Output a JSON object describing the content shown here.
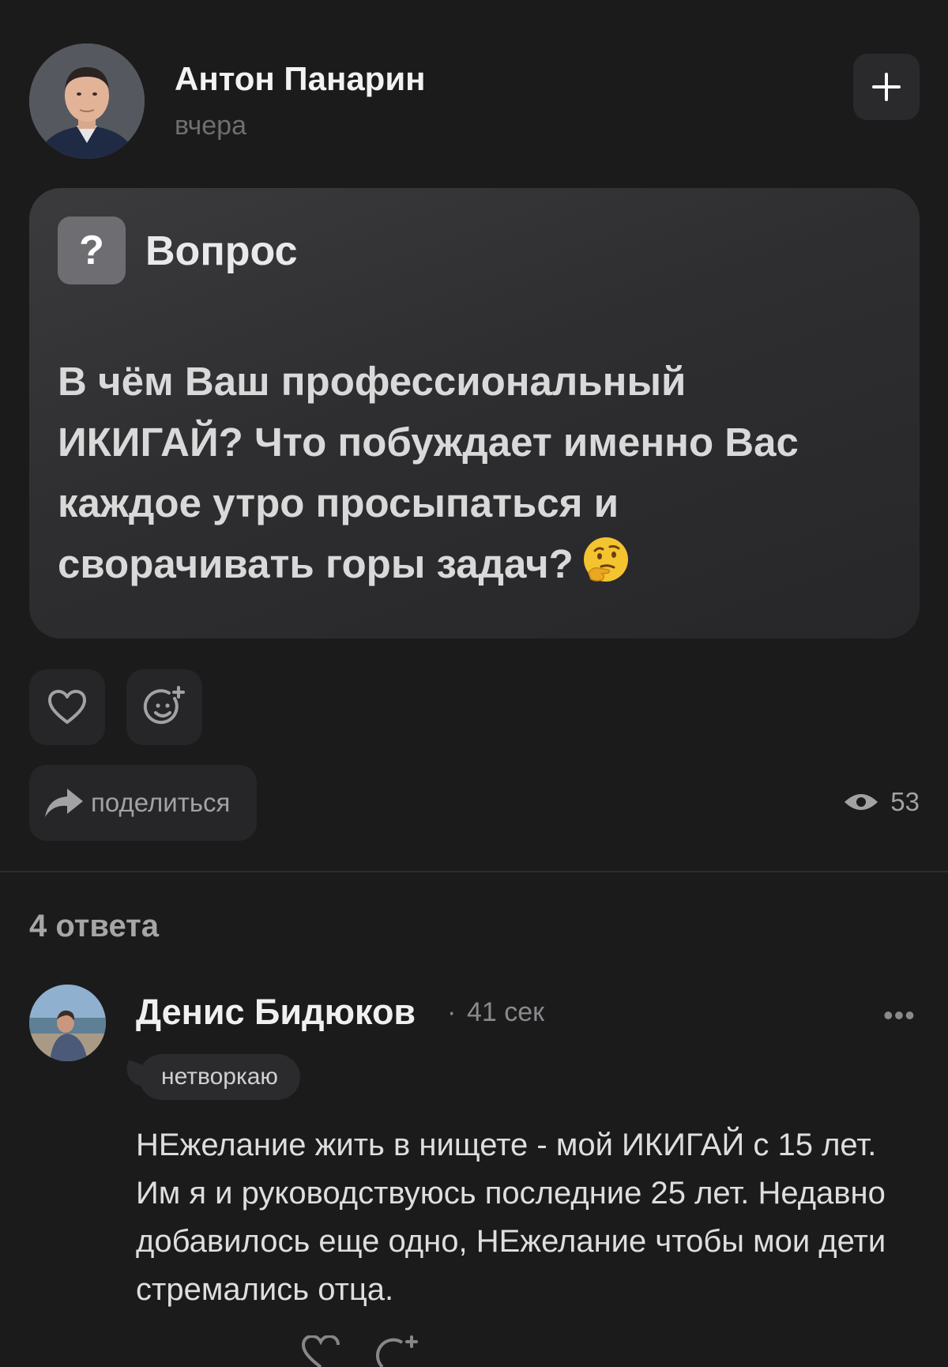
{
  "post": {
    "author": "Антон Панарин",
    "time": "вчера",
    "add_label": "+",
    "question_badge": "?",
    "question_label": "Вопрос",
    "question_text": "В чём Ваш профессиональный ИКИГАЙ? Что побуждает именно Вас каждое утро просыпаться и сворачивать горы задач?",
    "share_label": "поделиться",
    "views": "53"
  },
  "answers": {
    "count_label": "4 ответа",
    "items": [
      {
        "author": "Денис Бидюков",
        "separator": "·",
        "time": "41 сек",
        "more_label": "•••",
        "tag": "нетворкаю",
        "text": "НЕжелание жить в нищете - мой ИКИГАЙ с 15 лет. Им я и руководствуюсь последние 25 лет. Недавно добавилось еще одно, НЕжелание чтобы мои дети стремались отца."
      }
    ]
  },
  "icons": [
    "plus-icon",
    "question-icon",
    "thinking-face-emoji",
    "heart-icon",
    "add-reaction-icon",
    "share-arrow-icon",
    "eye-icon",
    "more-icon"
  ],
  "colors": {
    "background": "#1b1b1c",
    "card": "#2e2e30",
    "button": "#262628",
    "muted_text": "#a2a2a5",
    "emoji": "#f4c430"
  }
}
